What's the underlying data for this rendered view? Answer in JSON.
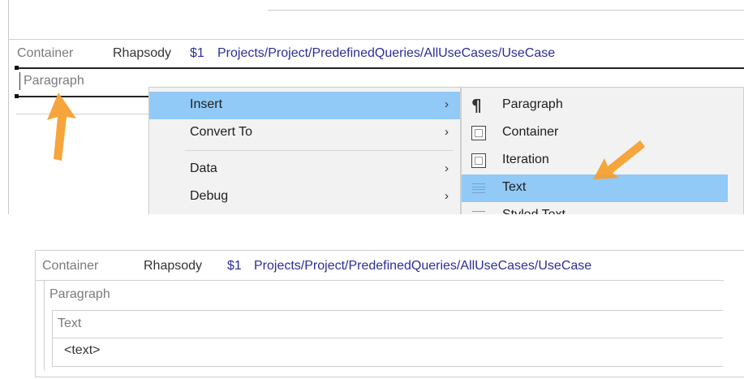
{
  "top": {
    "container_label": "Container",
    "rhapsody_label": "Rhapsody",
    "var_label": "$1",
    "path": "Projects/Project/PredefinedQueries/AllUseCases/UseCase",
    "paragraph_label": "Paragraph"
  },
  "context_menu": {
    "items": [
      {
        "label": "Insert",
        "highlighted": true,
        "has_submenu": true
      },
      {
        "label": "Convert To",
        "highlighted": false,
        "has_submenu": true
      },
      {
        "label": "Data",
        "highlighted": false,
        "has_submenu": true
      },
      {
        "label": "Debug",
        "highlighted": false,
        "has_submenu": true
      }
    ],
    "chevron": "›"
  },
  "submenu": {
    "items": [
      {
        "label": "Paragraph",
        "icon": "pilcrow-icon"
      },
      {
        "label": "Container",
        "icon": "container-box-icon"
      },
      {
        "label": "Iteration",
        "icon": "iteration-box-icon"
      },
      {
        "label": "Text",
        "icon": "text-lines-icon",
        "highlighted": true
      },
      {
        "label": "Styled Text",
        "icon": "styled-text-icon"
      }
    ],
    "pilcrow_glyph": "¶"
  },
  "bottom": {
    "container_label": "Container",
    "rhapsody_label": "Rhapsody",
    "var_label": "$1",
    "path": "Projects/Project/PredefinedQueries/AllUseCases/UseCase",
    "paragraph_label": "Paragraph",
    "text_label": "Text",
    "text_value": "<text>"
  },
  "colors": {
    "menu_highlight": "#91c9f7",
    "path_blue": "#2d2d9a",
    "arrow_orange": "#f4a030"
  }
}
